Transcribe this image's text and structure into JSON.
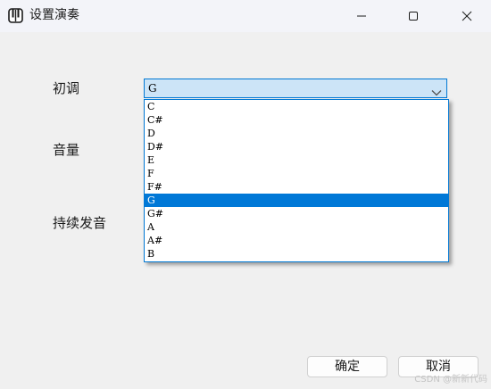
{
  "window": {
    "title": "设置演奏",
    "app_icon": "piano-icon",
    "controls": [
      "minimize-icon",
      "maximize-icon",
      "close-icon"
    ]
  },
  "form": {
    "key_label": "初调",
    "volume_label": "音量",
    "sustain_label": "持续发音"
  },
  "key_select": {
    "value": "G",
    "open": true,
    "options": [
      "C",
      "C#",
      "D",
      "D#",
      "E",
      "F",
      "F#",
      "G",
      "G#",
      "A",
      "A#",
      "B"
    ],
    "selected_index": 7
  },
  "buttons": {
    "ok": "确定",
    "cancel": "取消"
  },
  "watermark": "CSDN @新新代码",
  "colors": {
    "accent": "#0078d4",
    "selection": "#0078d7",
    "combo_background": "#cce4f7",
    "window_background": "#f0f0f0"
  }
}
